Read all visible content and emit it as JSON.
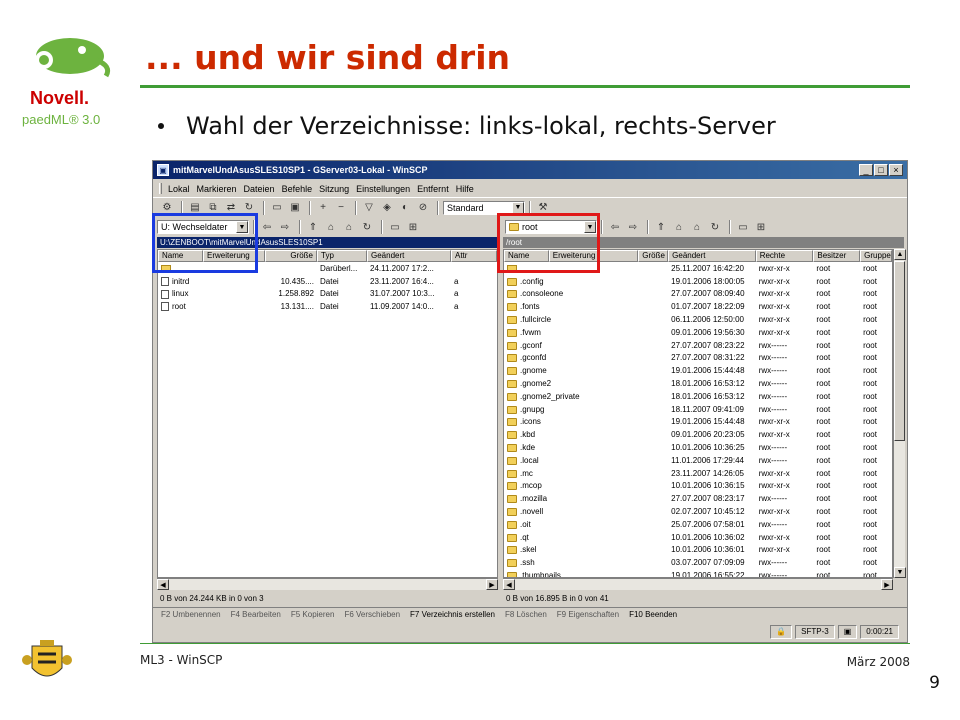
{
  "slide": {
    "title": "... und wir sind drin",
    "bullet": "Wahl der Verzeichnisse: links-lokal, rechts-Server",
    "footer_left": "ML3 - WinSCP",
    "footer_right": "März 2008",
    "page_number": "9",
    "logo_text_novell": "Novell.",
    "logo_text_paedml": "paedML® 3.0",
    "colors": {
      "title": "#cc2a00",
      "rule": "#3f9c35",
      "blue_highlight": "#1a3be0",
      "red_highlight": "#e01818"
    }
  },
  "window": {
    "title": "mitMarvelUndAsusSLES10SP1 - GServer03-Lokal - WinSCP",
    "controls": [
      "_",
      "□",
      "×"
    ],
    "menu": [
      "Lokal",
      "Markieren",
      "Dateien",
      "Befehle",
      "Sitzung",
      "Einstellungen",
      "Entfernt",
      "Hilfe"
    ],
    "toolbar_combo": "Standard"
  },
  "left_panel": {
    "drive_combo": "U: Wechseldater",
    "path": "U:\\ZENBOOT\\mitMarvelUndAsusSLES10SP1",
    "columns": [
      "Name",
      "Erweiterung",
      "Größe",
      "Typ",
      "Geändert",
      "Attr"
    ],
    "rows": [
      {
        "name": "..",
        "size": "",
        "type": "Darüberl...",
        "changed": "24.11.2007 17:2...",
        "attr": "",
        "icon": "up-folder-icon"
      },
      {
        "name": "initrd",
        "size": "10.435....",
        "type": "Datei",
        "changed": "23.11.2007 16:4...",
        "attr": "a",
        "icon": "file-icon"
      },
      {
        "name": "linux",
        "size": "1.258.892",
        "type": "Datei",
        "changed": "31.07.2007 10:3...",
        "attr": "a",
        "icon": "file-icon"
      },
      {
        "name": "root",
        "size": "13.131....",
        "type": "Datei",
        "changed": "11.09.2007 14:0...",
        "attr": "a",
        "icon": "file-icon"
      }
    ],
    "status": "0 B von 24.244 KB in 0 von 3"
  },
  "right_panel": {
    "dir_combo": "root",
    "path": "/root",
    "columns": [
      "Name",
      "Erweiterung",
      "Größe",
      "Geändert",
      "Rechte",
      "Besitzer",
      "Gruppe"
    ],
    "rows": [
      {
        "name": "..",
        "changed": "25.11.2007 16:42:20",
        "rights": "rwxr-xr-x",
        "owner": "root",
        "group": "root",
        "icon": "up-folder-icon"
      },
      {
        "name": ".config",
        "changed": "19.01.2006 18:00:05",
        "rights": "rwxr-xr-x",
        "owner": "root",
        "group": "root",
        "icon": "folder-icon"
      },
      {
        "name": ".consoleone",
        "changed": "27.07.2007 08:09:40",
        "rights": "rwxr-xr-x",
        "owner": "root",
        "group": "root",
        "icon": "folder-icon"
      },
      {
        "name": ".fonts",
        "changed": "01.07.2007 18:22:09",
        "rights": "rwxr-xr-x",
        "owner": "root",
        "group": "root",
        "icon": "folder-icon"
      },
      {
        "name": ".fullcircle",
        "changed": "06.11.2006 12:50:00",
        "rights": "rwxr-xr-x",
        "owner": "root",
        "group": "root",
        "icon": "folder-icon"
      },
      {
        "name": ".fvwm",
        "changed": "09.01.2006 19:56:30",
        "rights": "rwxr-xr-x",
        "owner": "root",
        "group": "root",
        "icon": "folder-icon"
      },
      {
        "name": ".gconf",
        "changed": "27.07.2007 08:23:22",
        "rights": "rwx------",
        "owner": "root",
        "group": "root",
        "icon": "folder-icon"
      },
      {
        "name": ".gconfd",
        "changed": "27.07.2007 08:31:22",
        "rights": "rwx------",
        "owner": "root",
        "group": "root",
        "icon": "folder-icon"
      },
      {
        "name": ".gnome",
        "changed": "19.01.2006 15:44:48",
        "rights": "rwx------",
        "owner": "root",
        "group": "root",
        "icon": "folder-icon"
      },
      {
        "name": ".gnome2",
        "changed": "18.01.2006 16:53:12",
        "rights": "rwx------",
        "owner": "root",
        "group": "root",
        "icon": "folder-icon"
      },
      {
        "name": ".gnome2_private",
        "changed": "18.01.2006 16:53:12",
        "rights": "rwx------",
        "owner": "root",
        "group": "root",
        "icon": "folder-icon"
      },
      {
        "name": ".gnupg",
        "changed": "18.11.2007 09:41:09",
        "rights": "rwx------",
        "owner": "root",
        "group": "root",
        "icon": "folder-icon"
      },
      {
        "name": ".icons",
        "changed": "19.01.2006 15:44:48",
        "rights": "rwxr-xr-x",
        "owner": "root",
        "group": "root",
        "icon": "folder-icon"
      },
      {
        "name": ".kbd",
        "changed": "09.01.2006 20:23:05",
        "rights": "rwxr-xr-x",
        "owner": "root",
        "group": "root",
        "icon": "folder-icon"
      },
      {
        "name": ".kde",
        "changed": "10.01.2006 10:36:25",
        "rights": "rwx------",
        "owner": "root",
        "group": "root",
        "icon": "folder-icon"
      },
      {
        "name": ".local",
        "changed": "11.01.2006 17:29:44",
        "rights": "rwx------",
        "owner": "root",
        "group": "root",
        "icon": "folder-icon"
      },
      {
        "name": ".mc",
        "changed": "23.11.2007 14:26:05",
        "rights": "rwxr-xr-x",
        "owner": "root",
        "group": "root",
        "icon": "folder-icon"
      },
      {
        "name": ".mcop",
        "changed": "10.01.2006 10:36:15",
        "rights": "rwxr-xr-x",
        "owner": "root",
        "group": "root",
        "icon": "folder-icon"
      },
      {
        "name": ".mozilla",
        "changed": "27.07.2007 08:23:17",
        "rights": "rwx------",
        "owner": "root",
        "group": "root",
        "icon": "folder-icon"
      },
      {
        "name": ".novell",
        "changed": "02.07.2007 10:45:12",
        "rights": "rwxr-xr-x",
        "owner": "root",
        "group": "root",
        "icon": "folder-icon"
      },
      {
        "name": ".oit",
        "changed": "25.07.2006 07:58:01",
        "rights": "rwx------",
        "owner": "root",
        "group": "root",
        "icon": "folder-icon"
      },
      {
        "name": ".qt",
        "changed": "10.01.2006 10:36:02",
        "rights": "rwxr-xr-x",
        "owner": "root",
        "group": "root",
        "icon": "folder-icon"
      },
      {
        "name": ".skel",
        "changed": "10.01.2006 10:36:01",
        "rights": "rwxr-xr-x",
        "owner": "root",
        "group": "root",
        "icon": "folder-icon"
      },
      {
        "name": ".ssh",
        "changed": "03.07.2007 07:09:09",
        "rights": "rwx------",
        "owner": "root",
        "group": "root",
        "icon": "folder-icon"
      },
      {
        "name": ".thumbnails",
        "changed": "19.01.2006 16:55:22",
        "rights": "rwx------",
        "owner": "root",
        "group": "root",
        "icon": "folder-icon"
      }
    ],
    "status": "0 B von 16.895 B in 0 von 41"
  },
  "function_keys": [
    {
      "label": "F2 Umbenennen",
      "enabled": false
    },
    {
      "label": "F4 Bearbeiten",
      "enabled": false
    },
    {
      "label": "F5 Kopieren",
      "enabled": false
    },
    {
      "label": "F6 Verschieben",
      "enabled": false
    },
    {
      "label": "F7 Verzeichnis erstellen",
      "enabled": true
    },
    {
      "label": "F8 Löschen",
      "enabled": false
    },
    {
      "label": "F9 Eigenschaften",
      "enabled": false
    },
    {
      "label": "F10 Beenden",
      "enabled": true
    }
  ],
  "statusbar": {
    "protocol": "SFTP-3",
    "time": "0:00:21"
  }
}
